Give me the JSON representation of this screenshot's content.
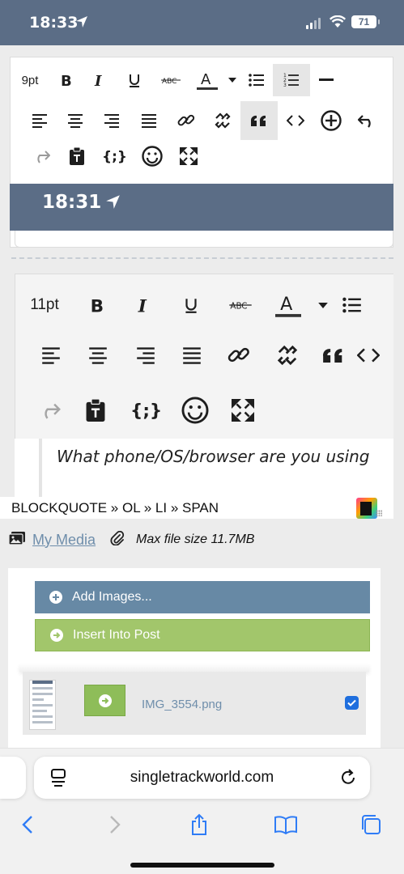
{
  "status_bar": {
    "time": "18:33",
    "battery": "71"
  },
  "quoted_post": {
    "font_size": "9pt",
    "nested_screenshot_time": "18:31"
  },
  "editor": {
    "font_size": "11pt",
    "body_text": "What phone/OS/browser are you using",
    "element_path": "BLOCKQUOTE » OL » LI » SPAN"
  },
  "media": {
    "my_media_label": "My Media",
    "max_file_size": "Max file size 11.7MB"
  },
  "upload": {
    "add_images_label": "Add Images...",
    "insert_label": "Insert Into Post",
    "file_name": "IMG_3554.png",
    "file_checked": true
  },
  "browser": {
    "url": "singletrackworld.com"
  },
  "colors": {
    "header_blue": "#5b6d86",
    "add_button": "#6789a5",
    "insert_button": "#a2c66b",
    "link": "#6f8eab",
    "checkbox": "#1f6fde",
    "safari_accent": "#2f7cf6"
  }
}
